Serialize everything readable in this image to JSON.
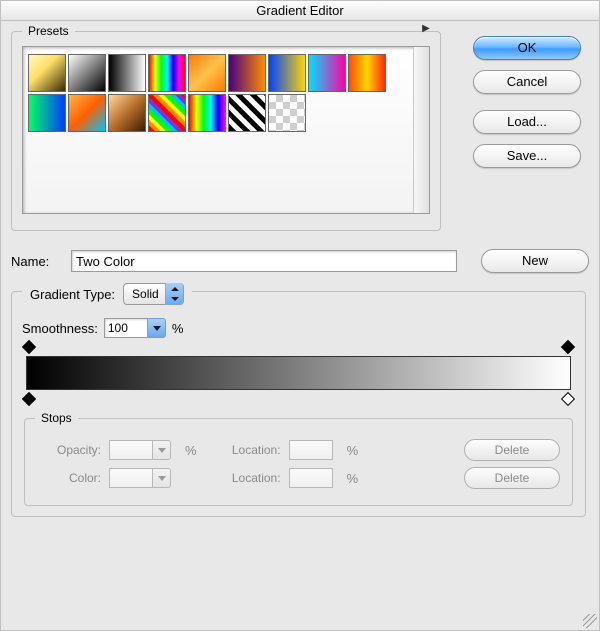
{
  "title": "Gradient Editor",
  "buttons": {
    "ok": "OK",
    "cancel": "Cancel",
    "load": "Load...",
    "save": "Save...",
    "new": "New"
  },
  "presets": {
    "label": "Presets",
    "swatches": [
      {
        "bg": "linear-gradient(135deg,#fff8c0,#ffe066 40%,#3a2a00)"
      },
      {
        "bg": "linear-gradient(135deg,#fff,#000)",
        "checker": true
      },
      {
        "bg": "linear-gradient(90deg,#000,#fff)"
      },
      {
        "bg": "linear-gradient(90deg,#ff0000,#ffff00,#00ff00,#00ffff,#0000ff,#ff00ff,#ff0000)"
      },
      {
        "bg": "linear-gradient(135deg,#ff7a00,#ffc34d,#ff7a00)"
      },
      {
        "bg": "linear-gradient(90deg,#4b0082,#ff8c00)"
      },
      {
        "bg": "linear-gradient(90deg,#0044ff,#ffd400)"
      },
      {
        "bg": "linear-gradient(90deg,#00e0ff,#ff00a8)"
      },
      {
        "bg": "linear-gradient(90deg,#ff4d00,#ffd500,#ff2a00)"
      },
      {
        "bg": "linear-gradient(90deg,#00ff66,#003cff)"
      },
      {
        "bg": "linear-gradient(135deg,#ffb347,#ff5e00,#00c2ff)"
      },
      {
        "bg": "linear-gradient(135deg,#ffd9a0,#b76e2a,#3a1d00)"
      },
      {
        "bg": "repeating-linear-gradient(45deg,#ff0000 0 4px,#ff8c00 4px 8px,#ffff00 8px 12px,#00ff00 12px 16px,#00bfff 16px 20px,#8a2be2 20px 24px)"
      },
      {
        "bg": "linear-gradient(90deg,#ff0000,#ffff00,#00ff00,#00ffff,#0000ff,#ff00ff)"
      },
      {
        "bg": "repeating-linear-gradient(45deg,#000 0 5px,#fff 5px 10px)"
      },
      {
        "bg": "",
        "checker": true
      }
    ]
  },
  "name": {
    "label": "Name:",
    "value": "Two Color"
  },
  "gradientType": {
    "label": "Gradient Type:",
    "value": "Solid"
  },
  "smoothness": {
    "label": "Smoothness:",
    "value": "100",
    "unit": "%"
  },
  "stops": {
    "label": "Stops",
    "opacity_label": "Opacity:",
    "color_label": "Color:",
    "location_label": "Location:",
    "unit": "%",
    "delete": "Delete"
  }
}
